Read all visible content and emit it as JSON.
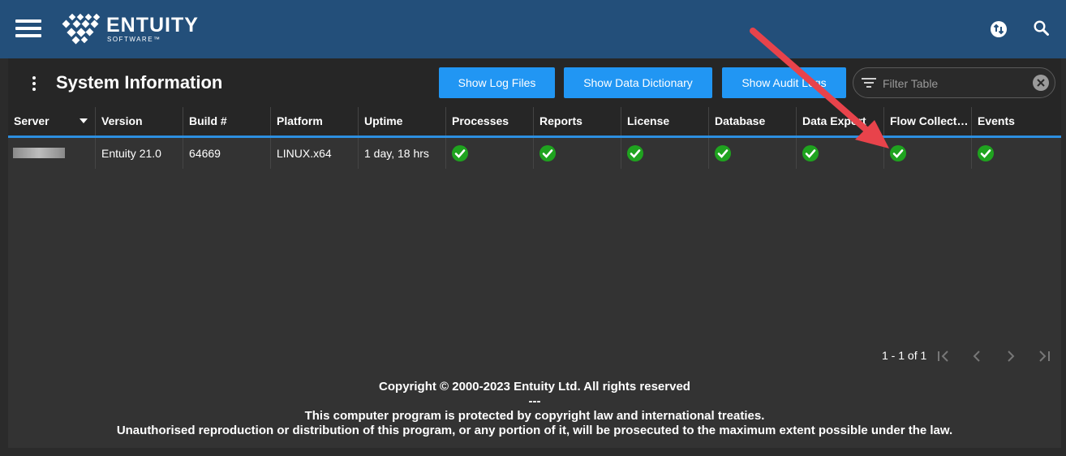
{
  "header": {
    "brand": "ENTUITY",
    "brand_sub": "SOFTWARE™",
    "icons": {
      "menu": "hamburger-icon",
      "sync": "sync-icon",
      "search": "search-icon"
    }
  },
  "page": {
    "title": "System Information",
    "buttons": {
      "log_files": "Show Log Files",
      "data_dictionary": "Show Data Dictionary",
      "audit_logs": "Show Audit Logs"
    },
    "filter_placeholder": "Filter Table"
  },
  "table": {
    "columns": [
      "Server",
      "Version",
      "Build #",
      "Platform",
      "Uptime",
      "Processes",
      "Reports",
      "License",
      "Database",
      "Data Export",
      "Flow Collect…",
      "Events"
    ],
    "rows": [
      {
        "server": "",
        "version": "Entuity 21.0",
        "build": "64669",
        "platform": "LINUX.x64",
        "uptime": "1 day, 18 hrs",
        "statuses": [
          "ok",
          "ok",
          "ok",
          "ok",
          "ok",
          "ok",
          "ok"
        ]
      }
    ]
  },
  "pagination": {
    "range": "1 - 1 of 1"
  },
  "footer": {
    "line1": "Copyright © 2000-2023 Entuity Ltd. All rights reserved",
    "line2": "---",
    "line3": "This computer program is protected by copyright law and international treaties.",
    "line4": "Unauthorised reproduction or distribution of this program, or any portion of it, will be prosecuted to the maximum extent possible under the law."
  },
  "colors": {
    "topbar": "#234f7a",
    "accent": "#2196f3",
    "ok": "#1fa31f",
    "annotation_arrow": "#e8434b"
  }
}
